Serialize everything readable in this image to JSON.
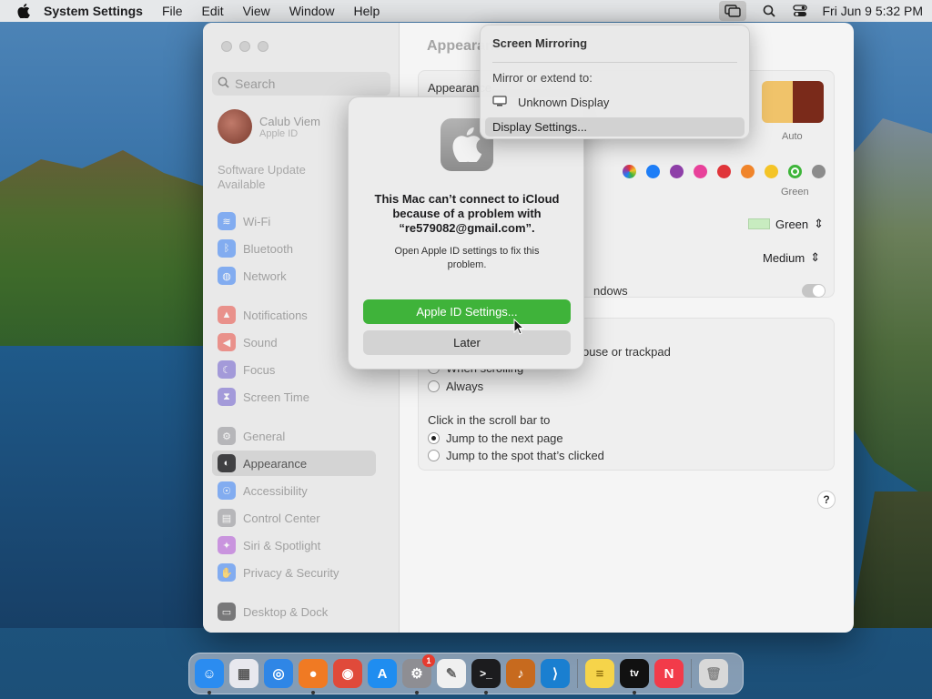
{
  "menubar": {
    "app_name": "System Settings",
    "items": [
      "File",
      "Edit",
      "View",
      "Window",
      "Help"
    ],
    "clock": "Fri Jun 9  5:32 PM"
  },
  "sidebar": {
    "search_placeholder": "Search",
    "profile": {
      "name": "Calub Viem",
      "subtitle": "Apple ID"
    },
    "software_update": "Software Update Available",
    "items": [
      {
        "label": "Wi-Fi",
        "icon": "wifi-icon",
        "color": "#2e7cf6"
      },
      {
        "label": "Bluetooth",
        "icon": "bluetooth-icon",
        "color": "#2e7cf6"
      },
      {
        "label": "Network",
        "icon": "globe-icon",
        "color": "#2e7cf6"
      },
      {
        "label": "Notifications",
        "icon": "bell-icon",
        "color": "#ea4a3f"
      },
      {
        "label": "Sound",
        "icon": "speaker-icon",
        "color": "#ea4a3f"
      },
      {
        "label": "Focus",
        "icon": "moon-icon",
        "color": "#6a5acd"
      },
      {
        "label": "Screen Time",
        "icon": "hourglass-icon",
        "color": "#6a5acd"
      },
      {
        "label": "General",
        "icon": "gear-icon",
        "color": "#8e8e93"
      },
      {
        "label": "Appearance",
        "icon": "appearance-icon",
        "color": "#1c1c1e"
      },
      {
        "label": "Accessibility",
        "icon": "accessibility-icon",
        "color": "#2e7cf6"
      },
      {
        "label": "Control Center",
        "icon": "control-center-icon",
        "color": "#8e8e93"
      },
      {
        "label": "Siri & Spotlight",
        "icon": "siri-icon",
        "color": "#b04fd6"
      },
      {
        "label": "Privacy & Security",
        "icon": "hand-icon",
        "color": "#2e7cf6"
      },
      {
        "label": "Desktop & Dock",
        "icon": "dock-icon",
        "color": "#1c1c1e"
      }
    ],
    "selected": "Appearance"
  },
  "main": {
    "title": "Appearance",
    "appearance_label": "Appearance",
    "auto_caption": "Auto",
    "accent_caption": "Green",
    "accent_colors": [
      "#b37ad1",
      "#1e7ef7",
      "#8e3fa8",
      "#e8419a",
      "#e0353a",
      "#f0842a",
      "#f4c427",
      "#3eb53a",
      "#8c8c8c"
    ],
    "highlight_value": "Green",
    "sidebar_icon_size": "Medium",
    "tinting_text": "ndows",
    "scroll_text": "ouse or trackpad",
    "scroll_partial": "When scrolling",
    "scroll_always": "Always",
    "click_label": "Click in the scroll bar to",
    "click_options": [
      "Jump to the next page",
      "Jump to the spot that’s clicked"
    ],
    "help": "?"
  },
  "alert": {
    "title": "This Mac can’t connect to iCloud because of a problem with “re579082@gmail.com”.",
    "message": "Open Apple ID settings to fix this problem.",
    "primary": "Apple ID Settings...",
    "secondary": "Later"
  },
  "mirror": {
    "title": "Screen Mirroring",
    "subtitle": "Mirror or extend to:",
    "display": "Unknown Display",
    "settings": "Display Settings..."
  },
  "dock": {
    "apps": [
      {
        "name": "Finder",
        "glyph": "☺",
        "color": "#2b8cf0",
        "running": true
      },
      {
        "name": "Launchpad",
        "glyph": "▦",
        "color": "#e8e8ee",
        "running": false
      },
      {
        "name": "Safari",
        "glyph": "◎",
        "color": "#2f86e6",
        "running": false
      },
      {
        "name": "Firefox",
        "glyph": "●",
        "color": "#f07a23",
        "running": true
      },
      {
        "name": "Chrome",
        "glyph": "◉",
        "color": "#e04a3a",
        "running": false
      },
      {
        "name": "App Store",
        "glyph": "A",
        "color": "#1f8df0",
        "running": false
      },
      {
        "name": "System Settings",
        "glyph": "⚙",
        "color": "#8e8e93",
        "running": true,
        "badge": "1"
      },
      {
        "name": "TextEdit",
        "glyph": "✎",
        "color": "#f0f0f0",
        "running": false
      },
      {
        "name": "Terminal",
        "glyph": ">_",
        "color": "#1c1c1e",
        "running": true
      },
      {
        "name": "Instruments",
        "glyph": "♪",
        "color": "#c76a1e",
        "running": false
      },
      {
        "name": "Visual Studio Code",
        "glyph": "⟩",
        "color": "#1a7fd0",
        "running": false
      },
      {
        "name": "Notes",
        "glyph": "≡",
        "color": "#f6d44a",
        "running": false
      },
      {
        "name": "Apple TV",
        "glyph": "tv",
        "color": "#111111",
        "running": true
      },
      {
        "name": "News",
        "glyph": "N",
        "color": "#f23b4a",
        "running": false
      },
      {
        "name": "Trash",
        "glyph": "🗑",
        "color": "#d8d8d8",
        "running": false
      }
    ]
  }
}
